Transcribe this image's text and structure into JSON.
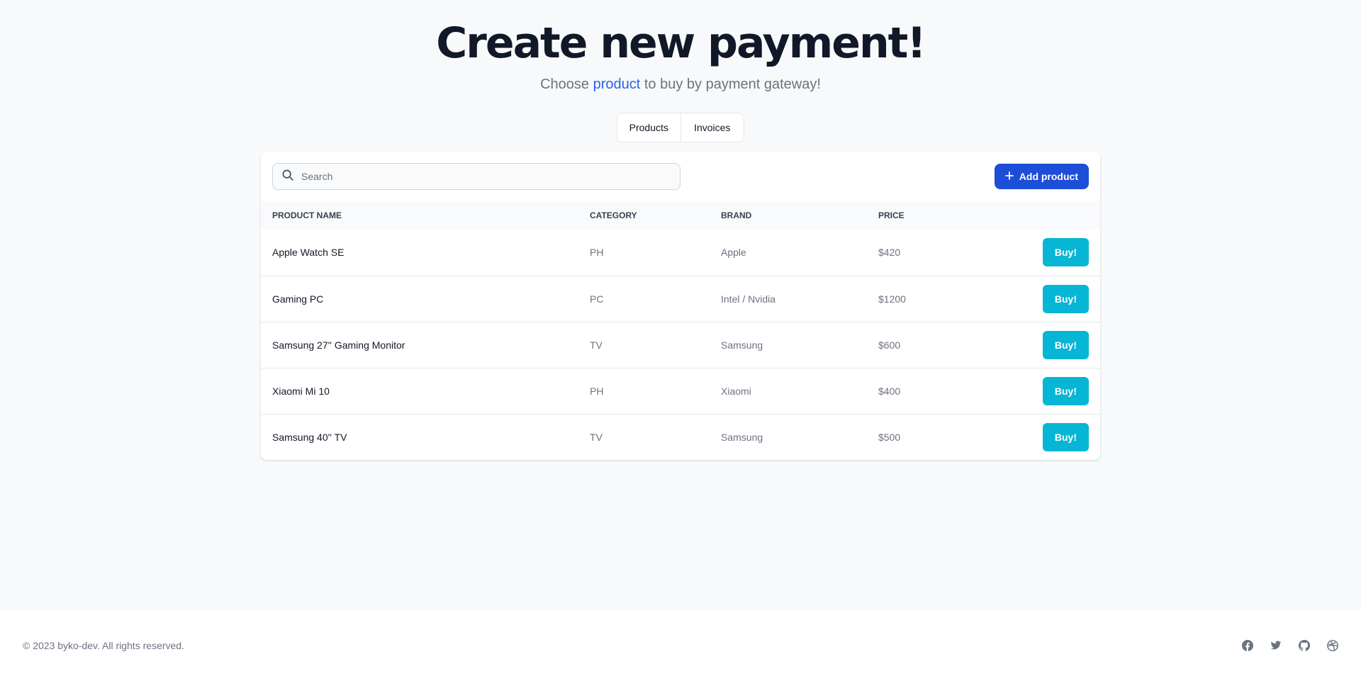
{
  "hero": {
    "title": "Create new payment!",
    "subtitle_before": "Choose ",
    "subtitle_link": "product",
    "subtitle_after": " to buy by payment gateway!"
  },
  "tabs": [
    {
      "label": "Products"
    },
    {
      "label": "Invoices"
    }
  ],
  "search": {
    "placeholder": "Search",
    "value": ""
  },
  "add_button": {
    "label": "Add product",
    "icon": "plus-icon"
  },
  "table": {
    "columns": [
      "PRODUCT NAME",
      "CATEGORY",
      "BRAND",
      "PRICE"
    ],
    "rows": [
      {
        "name": "Apple Watch SE",
        "category": "PH",
        "brand": "Apple",
        "price": "$420",
        "action": "Buy!"
      },
      {
        "name": "Gaming PC",
        "category": "PC",
        "brand": "Intel / Nvidia",
        "price": "$1200",
        "action": "Buy!"
      },
      {
        "name": "Samsung 27'' Gaming Monitor",
        "category": "TV",
        "brand": "Samsung",
        "price": "$600",
        "action": "Buy!"
      },
      {
        "name": "Xiaomi Mi 10",
        "category": "PH",
        "brand": "Xiaomi",
        "price": "$400",
        "action": "Buy!"
      },
      {
        "name": "Samsung 40'' TV",
        "category": "TV",
        "brand": "Samsung",
        "price": "$500",
        "action": "Buy!"
      }
    ]
  },
  "footer": {
    "copyright": "© 2023 byko-dev. All rights reserved.",
    "socials": [
      "facebook-icon",
      "twitter-icon",
      "github-icon",
      "dribbble-icon"
    ]
  },
  "colors": {
    "background": "#f8f9fb",
    "primary": "#1d4ed8",
    "link": "#2563eb",
    "buy": "#06b6d4",
    "title": "#111827",
    "muted": "#6b7280"
  }
}
